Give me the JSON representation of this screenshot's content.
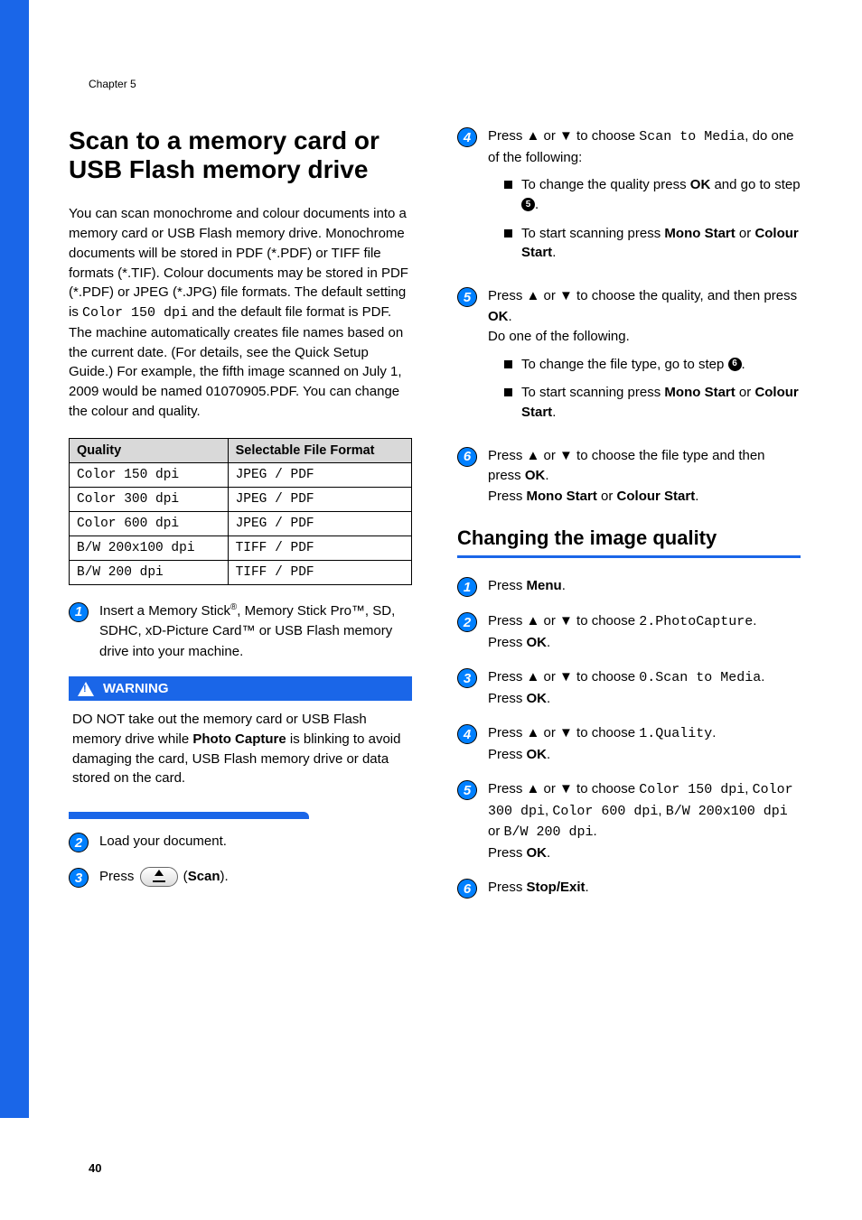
{
  "chapter": "Chapter 5",
  "page_number": "40",
  "h1": "Scan to a memory card or USB Flash memory drive",
  "intro": {
    "p1_a": "You can scan monochrome and colour documents into a memory card or USB Flash memory drive. Monochrome documents will be stored in PDF (*.PDF) or TIFF file formats (*.TIF). Colour documents may be stored in PDF (*.PDF) or JPEG (*.JPG) file formats. The default setting is ",
    "p1_mono": "Color 150 dpi",
    "p1_b": " and the default file format is PDF. The machine automatically creates file names based on the current date. (For details, see the Quick Setup Guide.) For example, the fifth image scanned on July 1, 2009 would be named 01070905.PDF. You can change the colour and quality."
  },
  "table": {
    "head": [
      "Quality",
      "Selectable File Format"
    ],
    "rows": [
      [
        "Color 150 dpi",
        "JPEG / PDF"
      ],
      [
        "Color 300 dpi",
        "JPEG / PDF"
      ],
      [
        "Color 600 dpi",
        "JPEG / PDF"
      ],
      [
        "B/W 200x100 dpi",
        "TIFF / PDF"
      ],
      [
        "B/W 200 dpi",
        "TIFF / PDF"
      ]
    ]
  },
  "left_steps": {
    "s1_a": "Insert a Memory Stick",
    "s1_b": ", Memory Stick Pro™, SD, SDHC, xD-Picture Card™ or USB Flash memory drive into your machine.",
    "s2": "Load your document.",
    "s3_a": "Press ",
    "s3_b": " (",
    "s3_scan": "Scan",
    "s3_c": ")."
  },
  "warning": {
    "label": "WARNING",
    "text_a": "DO NOT take out the memory card or USB Flash memory drive while ",
    "text_bold": "Photo Capture",
    "text_b": " is blinking to avoid damaging the card, USB Flash memory drive or data stored on the card."
  },
  "right_steps": {
    "s4_a": "Press ▲ or ▼ to choose ",
    "s4_mono": "Scan to Media",
    "s4_b": ", do one of the following:",
    "s4_bul1_a": "To change the quality press ",
    "s4_bul1_ok": "OK",
    "s4_bul1_b": " and go to step ",
    "s4_bul1_ref": "5",
    "s4_bul1_c": ".",
    "s4_bul2_a": "To start scanning press ",
    "s4_bul2_ms": "Mono Start",
    "s4_bul2_or": " or ",
    "s4_bul2_cs": "Colour Start",
    "s4_bul2_dot": ".",
    "s5_a": "Press ▲ or ▼ to choose the quality, and then press ",
    "s5_ok": "OK",
    "s5_b": ".",
    "s5_c": "Do one of the following.",
    "s5_bul1_a": "To change the file type, go to step ",
    "s5_bul1_ref": "6",
    "s5_bul1_b": ".",
    "s5_bul2_a": "To start scanning press ",
    "s5_bul2_ms": "Mono Start",
    "s5_bul2_or": " or ",
    "s5_bul2_cs": "Colour Start",
    "s5_bul2_dot": ".",
    "s6_a": "Press ▲ or ▼ to choose the file type and then press ",
    "s6_ok": "OK",
    "s6_b": ".",
    "s6_c": "Press ",
    "s6_ms": "Mono Start",
    "s6_or": " or ",
    "s6_cs": "Colour Start",
    "s6_dot": "."
  },
  "h2": "Changing the image quality",
  "change_steps": {
    "s1_a": "Press ",
    "s1_menu": "Menu",
    "s1_b": ".",
    "s2_a": "Press ▲ or ▼ to choose ",
    "s2_mono": "2.PhotoCapture",
    "s2_b": ".",
    "s2_c": "Press ",
    "s2_ok": "OK",
    "s2_d": ".",
    "s3_a": "Press ▲ or ▼ to choose ",
    "s3_mono": "0.Scan to Media",
    "s3_b": ".",
    "s3_c": "Press ",
    "s3_ok": "OK",
    "s3_d": ".",
    "s4_a": "Press ▲ or ▼ to choose ",
    "s4_mono": "1.Quality",
    "s4_b": ".",
    "s4_c": "Press ",
    "s4_ok": "OK",
    "s4_d": ".",
    "s5_a": "Press ▲ or ▼ to choose ",
    "s5_m1": "Color 150 dpi",
    "s5_c1": ", ",
    "s5_m2": "Color 300 dpi",
    "s5_c2": ", ",
    "s5_m3": "Color 600 dpi",
    "s5_c3": ", ",
    "s5_m4": "B/W 200x100 dpi",
    "s5_c4": " or ",
    "s5_m5": "B/W 200 dpi",
    "s5_c5": ".",
    "s5_c6": "Press ",
    "s5_ok": "OK",
    "s5_c7": ".",
    "s6_a": "Press ",
    "s6_se": "Stop/Exit",
    "s6_b": "."
  }
}
